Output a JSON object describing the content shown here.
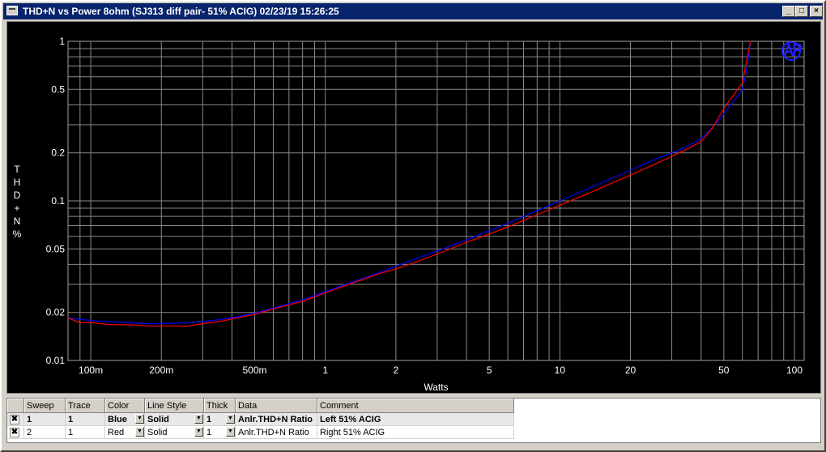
{
  "window": {
    "title": "THD+N vs Power 8ohm (SJ313 diff pair- 51% ACIG)  02/23/19 15:26:25"
  },
  "controls": {
    "minimize": "_",
    "maximize": "□",
    "close": "×"
  },
  "chart_data": {
    "type": "line",
    "xlabel": "Watts",
    "ylabel": "THD+N %",
    "xscale": "log",
    "yscale": "log",
    "xlim": [
      0.08,
      110
    ],
    "ylim": [
      0.01,
      1
    ],
    "grid": true,
    "legend": "table-below",
    "xticks": [
      {
        "v": 0.1,
        "t": "100m"
      },
      {
        "v": 0.2,
        "t": "200m"
      },
      {
        "v": 0.5,
        "t": "500m"
      },
      {
        "v": 1,
        "t": "1"
      },
      {
        "v": 2,
        "t": "2"
      },
      {
        "v": 5,
        "t": "5"
      },
      {
        "v": 10,
        "t": "10"
      },
      {
        "v": 20,
        "t": "20"
      },
      {
        "v": 50,
        "t": "50"
      },
      {
        "v": 100,
        "t": "100"
      }
    ],
    "yticks": [
      {
        "v": 0.01,
        "t": "0.01"
      },
      {
        "v": 0.02,
        "t": "0.02"
      },
      {
        "v": 0.05,
        "t": "0.05"
      },
      {
        "v": 0.1,
        "t": "0.1"
      },
      {
        "v": 0.2,
        "t": "0.2"
      },
      {
        "v": 0.5,
        "t": "0.5"
      },
      {
        "v": 1,
        "t": "1"
      }
    ],
    "series": [
      {
        "color": "#0000ff",
        "x": [
          0.08,
          0.1,
          0.12,
          0.15,
          0.18,
          0.22,
          0.27,
          0.33,
          0.4,
          0.5,
          0.6,
          0.8,
          1,
          1.3,
          1.7,
          2,
          2.5,
          3.3,
          4,
          5,
          6.5,
          8,
          10,
          13,
          16,
          20,
          25,
          30,
          35,
          40,
          45,
          50,
          55,
          60,
          63,
          65
        ],
        "y": [
          0.0185,
          0.0178,
          0.0175,
          0.0172,
          0.017,
          0.0171,
          0.0173,
          0.0178,
          0.0185,
          0.0198,
          0.0213,
          0.024,
          0.027,
          0.031,
          0.0355,
          0.039,
          0.044,
          0.051,
          0.057,
          0.065,
          0.076,
          0.087,
          0.1,
          0.118,
          0.135,
          0.156,
          0.18,
          0.2,
          0.22,
          0.245,
          0.29,
          0.35,
          0.42,
          0.5,
          0.7,
          1.0
        ]
      },
      {
        "color": "#ff0000",
        "x": [
          0.08,
          0.09,
          0.1,
          0.12,
          0.15,
          0.18,
          0.22,
          0.25,
          0.3,
          0.35,
          0.4,
          0.5,
          0.6,
          0.8,
          1,
          1.3,
          1.7,
          2,
          2.5,
          3.3,
          4,
          5,
          6.5,
          8,
          10,
          13,
          16,
          20,
          25,
          30,
          35,
          40,
          45,
          50,
          55,
          60,
          63,
          65
        ],
        "y": [
          0.0185,
          0.0172,
          0.0173,
          0.0168,
          0.0167,
          0.0164,
          0.0165,
          0.0163,
          0.017,
          0.0175,
          0.0182,
          0.0195,
          0.021,
          0.0235,
          0.0265,
          0.0305,
          0.035,
          0.0375,
          0.042,
          0.049,
          0.055,
          0.062,
          0.072,
          0.082,
          0.094,
          0.11,
          0.126,
          0.145,
          0.168,
          0.19,
          0.212,
          0.235,
          0.29,
          0.38,
          0.46,
          0.55,
          0.8,
          1.0
        ]
      }
    ]
  },
  "legend_table": {
    "headers": {
      "c0": "",
      "sweep": "Sweep",
      "trace": "Trace",
      "color": "Color",
      "style": "Line Style",
      "thick": "Thick",
      "data": "Data",
      "comment": "Comment"
    },
    "rows": [
      {
        "check": "✖",
        "sweep": "1",
        "trace": "1",
        "color": "Blue",
        "style": "Solid",
        "thick": "1",
        "data": "Anlr.THD+N Ratio",
        "comment": "Left 51% ACIG"
      },
      {
        "check": "✖",
        "sweep": "2",
        "trace": "1",
        "color": "Red",
        "style": "Solid",
        "thick": "1",
        "data": "Anlr.THD+N Ratio",
        "comment": "Right 51% ACIG"
      }
    ]
  }
}
